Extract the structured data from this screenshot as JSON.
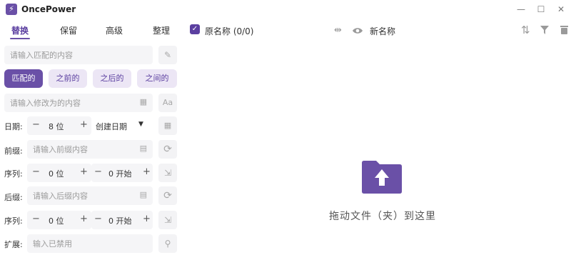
{
  "app": {
    "title": "OncePower"
  },
  "window": {
    "minimize": "—",
    "maximize": "☐",
    "close": "✕"
  },
  "tabs": [
    {
      "label": "替换",
      "active": true
    },
    {
      "label": "保留"
    },
    {
      "label": "高级"
    },
    {
      "label": "整理"
    }
  ],
  "list_header": {
    "original_label": "原名称 (0/0)",
    "new_label": "新名称",
    "checked": true
  },
  "replace": {
    "match_placeholder": "请输入匹配的内容",
    "modes": [
      {
        "label": "匹配的",
        "active": true
      },
      {
        "label": "之前的"
      },
      {
        "label": "之后的"
      },
      {
        "label": "之间的"
      }
    ],
    "modify_placeholder": "请输入修改为的内容"
  },
  "date_row": {
    "label": "日期:",
    "digits": "8 位",
    "type": "创建日期"
  },
  "prefix": {
    "label": "前缀:",
    "placeholder": "请输入前缀内容",
    "seq_label": "序列:",
    "digits": "0 位",
    "start": "0 开始"
  },
  "suffix": {
    "label": "后缀:",
    "placeholder": "请输入后缀内容",
    "seq_label": "序列:",
    "digits": "0 位",
    "start": "0 开始"
  },
  "extension": {
    "label": "扩展:",
    "placeholder": "输入已禁用"
  },
  "dropzone": {
    "text": "拖动文件（夹）到这里"
  },
  "colors": {
    "accent": "#6a50a7",
    "accent_light": "#ece6f5",
    "field_bg": "#f5f5f7"
  }
}
